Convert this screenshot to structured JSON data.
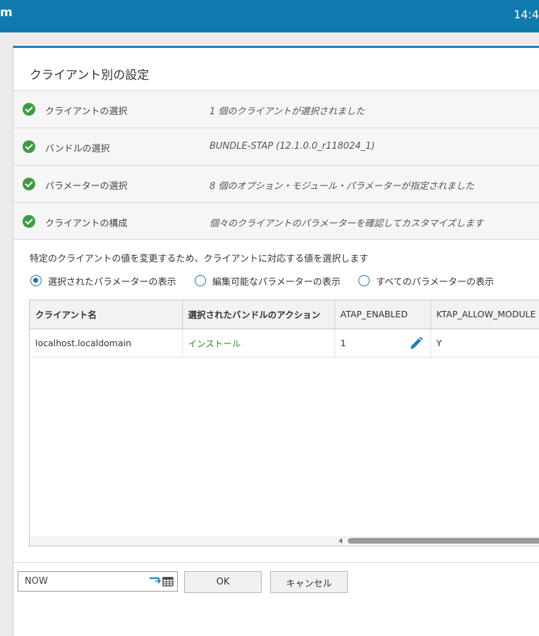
{
  "topbar": {
    "brand": "m",
    "clock": "14:4"
  },
  "panel": {
    "title": "クライアント別の設定"
  },
  "steps": [
    {
      "label": "クライアントの選択",
      "value": "1 個のクライアントが選択されました"
    },
    {
      "label": "バンドルの選択",
      "value": "BUNDLE-STAP (12.1.0.0_r118024_1)"
    },
    {
      "label": "パラメーターの選択",
      "value": "8 個のオプション・モジュール・パラメーターが指定されました"
    },
    {
      "label": "クライアントの構成",
      "value": "個々のクライアントのパラメーターを確認してカスタマイズします"
    }
  ],
  "instruction": "特定のクライアントの値を変更するため、クライアントに対応する値を選択します",
  "radios": [
    {
      "label": "選択されたパラメーターの表示",
      "selected": true
    },
    {
      "label": "編集可能なパラメーターの表示",
      "selected": false
    },
    {
      "label": "すべてのパラメーターの表示",
      "selected": false
    }
  ],
  "table": {
    "columns": [
      "クライアント名",
      "選択されたバンドルのアクション",
      "ATAP_ENABLED",
      "KTAP_ALLOW_MODULE"
    ],
    "rows": [
      {
        "client": "localhost.localdomain",
        "action": "インストール",
        "atap_enabled": "1",
        "ktap_allow_module": "Y"
      }
    ]
  },
  "footer": {
    "date_value": "NOW",
    "ok_label": "OK",
    "cancel_label": "キャンセル"
  },
  "colors": {
    "topbar": "#0f7aad",
    "accent": "#1f7fb6",
    "check": "#3f9b3f",
    "action_text": "#2e8b2e"
  }
}
